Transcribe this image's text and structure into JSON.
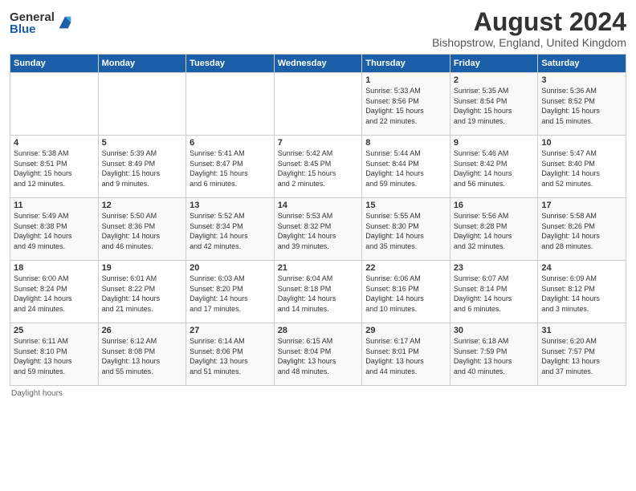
{
  "logo": {
    "general": "General",
    "blue": "Blue"
  },
  "title": "August 2024",
  "location": "Bishopstrow, England, United Kingdom",
  "days_header": [
    "Sunday",
    "Monday",
    "Tuesday",
    "Wednesday",
    "Thursday",
    "Friday",
    "Saturday"
  ],
  "footer": "Daylight hours",
  "weeks": [
    [
      {
        "day": "",
        "content": ""
      },
      {
        "day": "",
        "content": ""
      },
      {
        "day": "",
        "content": ""
      },
      {
        "day": "",
        "content": ""
      },
      {
        "day": "1",
        "content": "Sunrise: 5:33 AM\nSunset: 8:56 PM\nDaylight: 15 hours\nand 22 minutes."
      },
      {
        "day": "2",
        "content": "Sunrise: 5:35 AM\nSunset: 8:54 PM\nDaylight: 15 hours\nand 19 minutes."
      },
      {
        "day": "3",
        "content": "Sunrise: 5:36 AM\nSunset: 8:52 PM\nDaylight: 15 hours\nand 15 minutes."
      }
    ],
    [
      {
        "day": "4",
        "content": "Sunrise: 5:38 AM\nSunset: 8:51 PM\nDaylight: 15 hours\nand 12 minutes."
      },
      {
        "day": "5",
        "content": "Sunrise: 5:39 AM\nSunset: 8:49 PM\nDaylight: 15 hours\nand 9 minutes."
      },
      {
        "day": "6",
        "content": "Sunrise: 5:41 AM\nSunset: 8:47 PM\nDaylight: 15 hours\nand 6 minutes."
      },
      {
        "day": "7",
        "content": "Sunrise: 5:42 AM\nSunset: 8:45 PM\nDaylight: 15 hours\nand 2 minutes."
      },
      {
        "day": "8",
        "content": "Sunrise: 5:44 AM\nSunset: 8:44 PM\nDaylight: 14 hours\nand 59 minutes."
      },
      {
        "day": "9",
        "content": "Sunrise: 5:46 AM\nSunset: 8:42 PM\nDaylight: 14 hours\nand 56 minutes."
      },
      {
        "day": "10",
        "content": "Sunrise: 5:47 AM\nSunset: 8:40 PM\nDaylight: 14 hours\nand 52 minutes."
      }
    ],
    [
      {
        "day": "11",
        "content": "Sunrise: 5:49 AM\nSunset: 8:38 PM\nDaylight: 14 hours\nand 49 minutes."
      },
      {
        "day": "12",
        "content": "Sunrise: 5:50 AM\nSunset: 8:36 PM\nDaylight: 14 hours\nand 46 minutes."
      },
      {
        "day": "13",
        "content": "Sunrise: 5:52 AM\nSunset: 8:34 PM\nDaylight: 14 hours\nand 42 minutes."
      },
      {
        "day": "14",
        "content": "Sunrise: 5:53 AM\nSunset: 8:32 PM\nDaylight: 14 hours\nand 39 minutes."
      },
      {
        "day": "15",
        "content": "Sunrise: 5:55 AM\nSunset: 8:30 PM\nDaylight: 14 hours\nand 35 minutes."
      },
      {
        "day": "16",
        "content": "Sunrise: 5:56 AM\nSunset: 8:28 PM\nDaylight: 14 hours\nand 32 minutes."
      },
      {
        "day": "17",
        "content": "Sunrise: 5:58 AM\nSunset: 8:26 PM\nDaylight: 14 hours\nand 28 minutes."
      }
    ],
    [
      {
        "day": "18",
        "content": "Sunrise: 6:00 AM\nSunset: 8:24 PM\nDaylight: 14 hours\nand 24 minutes."
      },
      {
        "day": "19",
        "content": "Sunrise: 6:01 AM\nSunset: 8:22 PM\nDaylight: 14 hours\nand 21 minutes."
      },
      {
        "day": "20",
        "content": "Sunrise: 6:03 AM\nSunset: 8:20 PM\nDaylight: 14 hours\nand 17 minutes."
      },
      {
        "day": "21",
        "content": "Sunrise: 6:04 AM\nSunset: 8:18 PM\nDaylight: 14 hours\nand 14 minutes."
      },
      {
        "day": "22",
        "content": "Sunrise: 6:06 AM\nSunset: 8:16 PM\nDaylight: 14 hours\nand 10 minutes."
      },
      {
        "day": "23",
        "content": "Sunrise: 6:07 AM\nSunset: 8:14 PM\nDaylight: 14 hours\nand 6 minutes."
      },
      {
        "day": "24",
        "content": "Sunrise: 6:09 AM\nSunset: 8:12 PM\nDaylight: 14 hours\nand 3 minutes."
      }
    ],
    [
      {
        "day": "25",
        "content": "Sunrise: 6:11 AM\nSunset: 8:10 PM\nDaylight: 13 hours\nand 59 minutes."
      },
      {
        "day": "26",
        "content": "Sunrise: 6:12 AM\nSunset: 8:08 PM\nDaylight: 13 hours\nand 55 minutes."
      },
      {
        "day": "27",
        "content": "Sunrise: 6:14 AM\nSunset: 8:06 PM\nDaylight: 13 hours\nand 51 minutes."
      },
      {
        "day": "28",
        "content": "Sunrise: 6:15 AM\nSunset: 8:04 PM\nDaylight: 13 hours\nand 48 minutes."
      },
      {
        "day": "29",
        "content": "Sunrise: 6:17 AM\nSunset: 8:01 PM\nDaylight: 13 hours\nand 44 minutes."
      },
      {
        "day": "30",
        "content": "Sunrise: 6:18 AM\nSunset: 7:59 PM\nDaylight: 13 hours\nand 40 minutes."
      },
      {
        "day": "31",
        "content": "Sunrise: 6:20 AM\nSunset: 7:57 PM\nDaylight: 13 hours\nand 37 minutes."
      }
    ]
  ]
}
